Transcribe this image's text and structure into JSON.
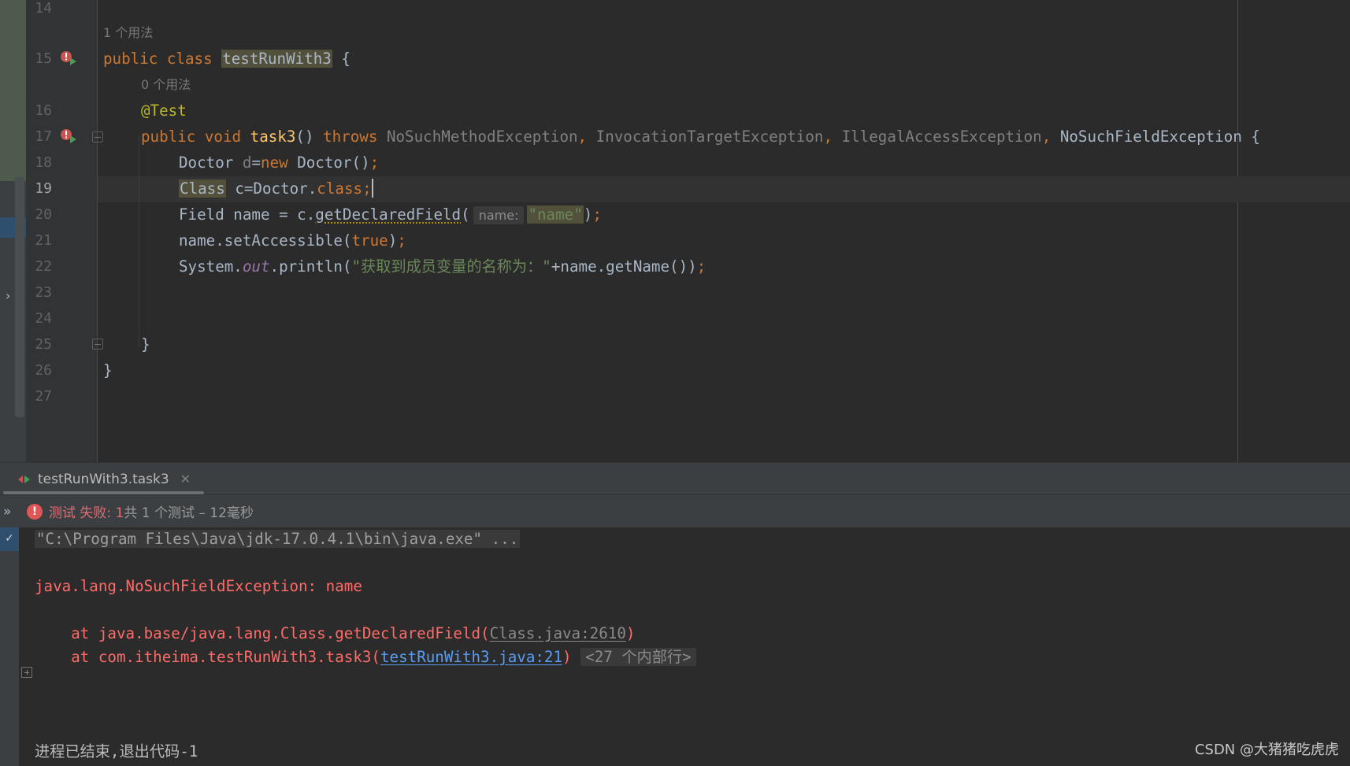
{
  "editor": {
    "line_numbers": [
      "14",
      "15",
      "16",
      "17",
      "18",
      "19",
      "20",
      "21",
      "22",
      "23",
      "24",
      "25",
      "26",
      "27"
    ],
    "active_line": "19",
    "usage_class": "1 个用法",
    "usage_method": "0 个用法",
    "code": {
      "l15_public": "public",
      "l15_class": "class",
      "l15_name": "testRunWith3",
      "l15_brace": " {",
      "l16_annotation": "@Test",
      "l17_public": "public",
      "l17_void": "void",
      "l17_name": "task3",
      "l17_parens": "() ",
      "l17_throws": "throws",
      "l17_ex1": "NoSuchMethodException",
      "l17_ex2": "InvocationTargetException",
      "l17_ex3": "IllegalAccessException",
      "l17_ex4": "NoSuchFieldException",
      "l17_end": " {",
      "l18_type": "Doctor ",
      "l18_var": "d",
      "l18_eq": "=",
      "l18_new": "new",
      "l18_rest": " Doctor()",
      "l18_semi": ";",
      "l19_type": "Class",
      "l19_rest": " c=Doctor.",
      "l19_class": "class",
      "l19_semi": ";",
      "l20_start": "Field name = c.",
      "l20_method": "getDeclaredField",
      "l20_open": "(",
      "l20_hint": "name:",
      "l20_arg": "\"name\"",
      "l20_close": ")",
      "l20_semi": ";",
      "l21_start": "name.setAccessible(",
      "l21_true": "true",
      "l21_close": ")",
      "l21_semi": ";",
      "l22_start": "System.",
      "l22_out": "out",
      "l22_mid": ".println(",
      "l22_str": "\"获取到成员变量的名称为：\"",
      "l22_rest": "+name.getName())",
      "l22_semi": ";",
      "l25_brace": "}",
      "l26_brace": "}"
    }
  },
  "run_panel": {
    "tab_label": "testRunWith3.task3",
    "status": {
      "fail_label": "测试 失败: 1",
      "summary": "共 1 个测试 – 12毫秒"
    },
    "console": {
      "command": "\"C:\\Program Files\\Java\\jdk-17.0.4.1\\bin\\java.exe\" ...",
      "exception": "java.lang.NoSuchFieldException: name",
      "trace1_prefix": "    at java.base/java.lang.Class.getDeclaredField(",
      "trace1_link": "Class.java:2610",
      "trace1_suffix": ")",
      "trace2_prefix": "    at com.itheima.testRunWith3.task3(",
      "trace2_link": "testRunWith3.java:21",
      "trace2_suffix": ")",
      "internal_lines": "<27 个内部行>",
      "exit": "进程已结束,退出代码-1"
    }
  },
  "watermark": "CSDN @大猪猪吃虎虎",
  "colors": {
    "keyword": "#cc7832",
    "string": "#6a8759",
    "error": "#ff6b68",
    "link": "#589df6"
  }
}
